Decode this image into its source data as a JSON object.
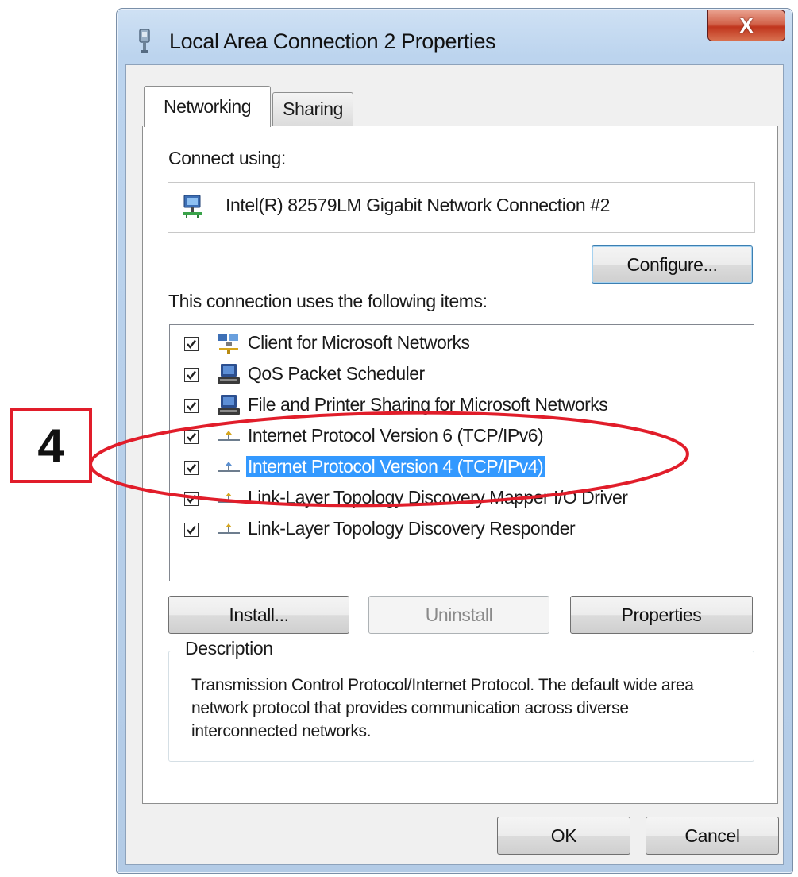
{
  "window": {
    "title": "Local Area Connection 2 Properties",
    "close_glyph": "X"
  },
  "tabs": [
    {
      "label": "Networking",
      "selected": true
    },
    {
      "label": "Sharing",
      "selected": false
    }
  ],
  "connect_using": {
    "label": "Connect using:",
    "adapter": "Intel(R) 82579LM Gigabit Network Connection #2",
    "adapter_icon": "network-adapter-icon",
    "configure_button": "Configure..."
  },
  "items": {
    "label": "This connection uses the following items:",
    "list": [
      {
        "label": "Client for Microsoft Networks",
        "checked": true,
        "icon": "client-network-icon",
        "selected": false
      },
      {
        "label": "QoS Packet Scheduler",
        "checked": true,
        "icon": "computer-service-icon",
        "selected": false
      },
      {
        "label": "File and Printer Sharing for Microsoft Networks",
        "checked": true,
        "icon": "computer-service-icon",
        "selected": false
      },
      {
        "label": "Internet Protocol Version 6 (TCP/IPv6)",
        "checked": true,
        "icon": "protocol-icon",
        "selected": false
      },
      {
        "label": "Internet Protocol Version 4 (TCP/IPv4)",
        "checked": true,
        "icon": "protocol-icon",
        "selected": true
      },
      {
        "label": "Link-Layer Topology Discovery Mapper I/O Driver",
        "checked": true,
        "icon": "protocol-icon",
        "selected": false
      },
      {
        "label": "Link-Layer Topology Discovery Responder",
        "checked": true,
        "icon": "protocol-icon",
        "selected": false
      }
    ],
    "install_button": "Install...",
    "uninstall_button": "Uninstall",
    "uninstall_enabled": false,
    "properties_button": "Properties"
  },
  "description": {
    "legend": "Description",
    "text": "Transmission Control Protocol/Internet Protocol. The default wide area network protocol that provides communication across diverse interconnected networks."
  },
  "footer": {
    "ok_button": "OK",
    "cancel_button": "Cancel"
  },
  "annotation": {
    "step_number": "4",
    "color": "#e11d2a"
  },
  "colors": {
    "selection": "#3399ff",
    "close_button": "#c0351d",
    "title_bar": "#bcd4ee"
  }
}
